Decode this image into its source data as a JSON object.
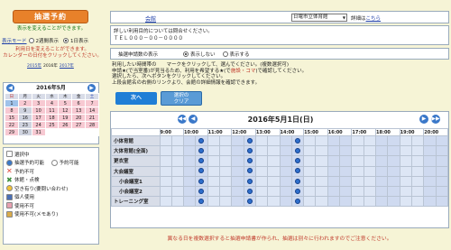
{
  "left": {
    "title": "抽選予約",
    "note_green_1": "表示を変えることができます。",
    "display_mode_label": "表示モード",
    "opt_2month": "2週間表示",
    "opt_1day": "1日表示",
    "note_red_1": "利用日を変えることができます。",
    "note_red_2": "カレンダーの日付をクリックしてください。",
    "months": [
      "2015年",
      "2016年",
      "2017年"
    ],
    "calendar": {
      "title": "2016年5月",
      "dow": [
        "日",
        "月",
        "火",
        "水",
        "木",
        "金",
        "土"
      ],
      "weeks": [
        [
          "1",
          "2",
          "3",
          "4",
          "5",
          "6",
          "7"
        ],
        [
          "8",
          "9",
          "10",
          "11",
          "12",
          "13",
          "14"
        ],
        [
          "15",
          "16",
          "17",
          "18",
          "19",
          "20",
          "21"
        ],
        [
          "22",
          "23",
          "24",
          "25",
          "26",
          "27",
          "28"
        ],
        [
          "29",
          "30",
          "31",
          "",
          "",
          "",
          ""
        ]
      ]
    },
    "legend": [
      {
        "label": "選択中",
        "color": "#ffffff"
      },
      {
        "label": "抽選予約可能　",
        "label2": "予約可能",
        "color": "#3a78c9"
      },
      {
        "label": "予約不可",
        "color": "#e0483c"
      },
      {
        "label": "休館・点検",
        "color": "#3e8f3e"
      },
      {
        "label": "空き有り(要問い合わせ)",
        "color": "#f2c237"
      },
      {
        "label": "個人使用",
        "color": "#4a6fb5"
      },
      {
        "label": "使用不可",
        "color": "#e6a0b0"
      },
      {
        "label": "使用不可(メモあり)",
        "color": "#d9ab4a"
      }
    ]
  },
  "facility": {
    "label": "会館",
    "selected": "日電市立体育館",
    "detail_prefix": "詳細は",
    "detail_link": "こちら"
  },
  "info": {
    "line1": "詳しい利用目的については問合せください。",
    "line2": "ＴＥＬ０００－００－００００"
  },
  "toggle": {
    "label": "抽選申請数の表示",
    "opt_hide": "表示しない",
    "opt_show": "表示する"
  },
  "instructions": {
    "line1": "利用したい時間帯の　　マークをクリックして、選んでください。(複数選択可)",
    "line2a": "申請★(で当室番)が見当るため、利用を希望する★(で",
    "line2b": "施設・コマ",
    "line2c": ")で確認してください。",
    "line3": "選択したら、次へボタンをクリックしてください。",
    "line4": "上段会館名の右側のリンクより、会館の詳細情報を確認できます。"
  },
  "buttons": {
    "next": "次へ",
    "clear_1": "選択の",
    "clear_2": "クリア"
  },
  "grid": {
    "date": "2016年5月1日(日)",
    "times": [
      "9:00",
      "10:00",
      "11:00",
      "12:00",
      "13:00",
      "14:00",
      "15:00",
      "16:00",
      "17:00",
      "18:00",
      "19:00",
      "20:00"
    ],
    "rooms": [
      "小体育館",
      "大体育館(全面)",
      "更衣室",
      "大会議室",
      "小会議室1",
      "小会議室2",
      "トレーニング室"
    ]
  },
  "bottom_note": "異なる日を複数選択すると抽選申請書が作られ、抽選は別々に行われますのでご注意ください。"
}
